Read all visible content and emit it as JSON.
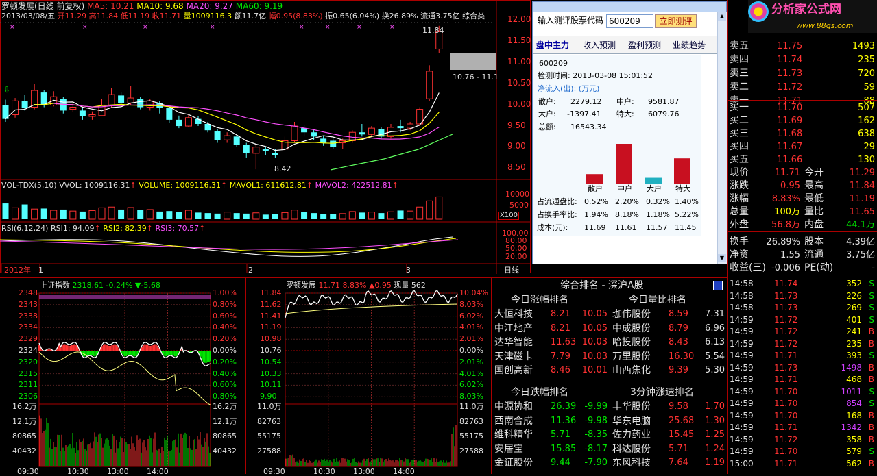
{
  "header": {
    "line1": {
      "name": "罗顿发展(日线 前复权)",
      "ma5": "MA5: 10.21",
      "ma10": "MA10: 9.68",
      "ma20": "MA20: 9.27",
      "ma60": "MA60: 9.19"
    },
    "line2": {
      "date": "2013/03/08/五",
      "open": "开11.29",
      "high": "高11.84",
      "low": "低11.19",
      "close": "收11.71",
      "vol": "量1009116.3",
      "amt": "额11.7亿",
      "chg": "幅0.95(8.83%)",
      "amp": "振0.65(6.04%)",
      "turn": "换26.89%",
      "float": "流通3.75亿",
      "comp": "综合类"
    }
  },
  "kline": {
    "price_labels": [
      "12.00",
      "11.50",
      "11.00",
      "10.50",
      "10.00",
      "9.50",
      "9.00",
      "8.50"
    ],
    "hi_mark": "11.84",
    "lo_mark": "8.42",
    "cursor_price": "10.76 - 11.1"
  },
  "vol_panel": {
    "title": "VOL-TDX(5,10)",
    "vvol": "VVOL: 1009116.31",
    "volume": "VOLUME: 1009116.31",
    "mavol1": "MAVOL1: 611612.81",
    "mavol2": "MAVOL2: 422512.81",
    "labels": [
      "10000",
      "5000"
    ],
    "unit": "X100"
  },
  "rsi_panel": {
    "title": "RSI(6,12,24)",
    "rsi1": "RSI1: 94.09",
    "rsi2": "RSI2: 82.39",
    "rsi3": "RSI3: 70.57",
    "labels": [
      "100.00",
      "80.00",
      "50.00",
      "20.00"
    ]
  },
  "timebar": {
    "year": "2012年",
    "m1": "1",
    "m2": "2",
    "m3": "3",
    "period": "日线"
  },
  "popup": {
    "input_label": "输入测评股票代码",
    "code": "600209",
    "btn": "立即测评",
    "tabs": [
      "盘中主力",
      "收入预测",
      "盈利预测",
      "业绩趋势"
    ],
    "code2": "600209",
    "time": "检测时间: 2013-03-08 15:01:52",
    "flow_title": "净流入(出): (万元)",
    "flow": {
      "sh_l": "散户:",
      "sh": "2279.12",
      "zh_l": "中户:",
      "zh": "9581.87",
      "dh_l": "大户:",
      "dh": "-1397.41",
      "th_l": "特大:",
      "th": "6079.76",
      "total_l": "总额:",
      "total": "16543.34"
    },
    "bars": {
      "labels": [
        "散户",
        "中户",
        "大户",
        "特大"
      ],
      "values": [
        2279.12,
        9581.87,
        -1397.41,
        6079.76
      ]
    },
    "rows": [
      {
        "label": "占流通盘比:",
        "v": [
          "0.52%",
          "2.20%",
          "0.32%",
          "1.40%"
        ]
      },
      {
        "label": "占换手率比:",
        "v": [
          "1.94%",
          "8.18%",
          "1.18%",
          "5.22%"
        ]
      },
      {
        "label": "成本(元):",
        "v": [
          "11.69",
          "11.61",
          "11.57",
          "11.45"
        ]
      }
    ]
  },
  "logo": {
    "main": "分析家公式网",
    "sub": "www.88gs.com"
  },
  "orderbook": {
    "sells": [
      {
        "l": "卖五",
        "p": "11.75",
        "v": "1493"
      },
      {
        "l": "卖四",
        "p": "11.74",
        "v": "235"
      },
      {
        "l": "卖三",
        "p": "11.73",
        "v": "720"
      },
      {
        "l": "卖二",
        "p": "11.72",
        "v": "59"
      },
      {
        "l": "卖一",
        "p": "11.71",
        "v": "88"
      }
    ],
    "buys": [
      {
        "l": "买一",
        "p": "11.70",
        "v": "507"
      },
      {
        "l": "买二",
        "p": "11.69",
        "v": "162"
      },
      {
        "l": "买三",
        "p": "11.68",
        "v": "638"
      },
      {
        "l": "买四",
        "p": "11.67",
        "v": "29"
      },
      {
        "l": "买五",
        "p": "11.66",
        "v": "130"
      }
    ]
  },
  "quote": [
    {
      "l1": "现价",
      "v1": "11.71",
      "l2": "今开",
      "v2": "11.29"
    },
    {
      "l1": "涨跌",
      "v1": "0.95",
      "l2": "最高",
      "v2": "11.84"
    },
    {
      "l1": "涨幅",
      "v1": "8.83%",
      "l2": "最低",
      "v2": "11.19"
    },
    {
      "l1": "总量",
      "v1": "100万",
      "l2": "量比",
      "v2": "11.65"
    },
    {
      "l1": "外盘",
      "v1": "56.8万",
      "l2": "内盘",
      "v2": "44.1万"
    },
    {
      "l1": "换手",
      "v1": "26.89%",
      "l2": "股本",
      "v2": "4.39亿"
    },
    {
      "l1": "净资",
      "v1": "1.55",
      "l2": "流通",
      "v2": "3.75亿"
    },
    {
      "l1": "收益(三)",
      "v1": "-0.006",
      "l2": "PE(动)",
      "v2": "-"
    }
  ],
  "ticks": [
    {
      "t": "14:58",
      "p": "11.74",
      "v": "352",
      "s": "S"
    },
    {
      "t": "14:58",
      "p": "11.73",
      "v": "226",
      "s": "S"
    },
    {
      "t": "14:58",
      "p": "11.73",
      "v": "269",
      "s": "S"
    },
    {
      "t": "14:59",
      "p": "11.72",
      "v": "401",
      "s": "S"
    },
    {
      "t": "14:59",
      "p": "11.72",
      "v": "241",
      "s": "B"
    },
    {
      "t": "14:59",
      "p": "11.72",
      "v": "235",
      "s": "B"
    },
    {
      "t": "14:59",
      "p": "11.71",
      "v": "393",
      "s": "S"
    },
    {
      "t": "14:59",
      "p": "11.73",
      "v": "1498",
      "s": "B"
    },
    {
      "t": "14:59",
      "p": "11.71",
      "v": "468",
      "s": "B"
    },
    {
      "t": "14:59",
      "p": "11.70",
      "v": "1011",
      "s": "S"
    },
    {
      "t": "14:59",
      "p": "11.70",
      "v": "854",
      "s": "S"
    },
    {
      "t": "14:59",
      "p": "11.70",
      "v": "168",
      "s": "B"
    },
    {
      "t": "14:59",
      "p": "11.71",
      "v": "1342",
      "s": "B"
    },
    {
      "t": "14:59",
      "p": "11.72",
      "v": "358",
      "s": "B"
    },
    {
      "t": "14:59",
      "p": "11.70",
      "v": "579",
      "s": "S"
    },
    {
      "t": "15:00",
      "p": "11.71",
      "v": "562",
      "s": "B"
    }
  ],
  "index_panel": {
    "title": "上证指数",
    "value": "2318.61",
    "chg": "-0.24%",
    "delta": "▼-5.68",
    "left": [
      "2348",
      "2343",
      "2338",
      "2334",
      "2329",
      "2324",
      "2320",
      "2315",
      "2311",
      "2306"
    ],
    "right": [
      "1.00%",
      "0.80%",
      "0.60%",
      "0.40%",
      "0.20%",
      "0.00%",
      "0.20%",
      "0.40%",
      "0.60%",
      "0.80%"
    ],
    "vol_l": [
      "16.2万",
      "12.1万",
      "80865",
      "40432"
    ],
    "times": [
      "09:30",
      "10:30",
      "13:00",
      "14:00"
    ]
  },
  "stock_panel": {
    "title": "罗顿发展",
    "value": "11.71",
    "pct": "8.83%",
    "delta": "▲0.95",
    "cur": "现量 562",
    "left": [
      "11.84",
      "11.62",
      "11.41",
      "11.19",
      "10.98",
      "10.76",
      "10.54",
      "10.33",
      "10.11",
      "9.90"
    ],
    "right": [
      "10.04%",
      "8.03%",
      "6.02%",
      "4.01%",
      "2.01%",
      "0.00%",
      "2.01%",
      "4.01%",
      "6.02%",
      "8.03%"
    ],
    "vol_l": [
      "11.0万",
      "82763",
      "55175",
      "27588"
    ],
    "times": [
      "09:30",
      "10:30",
      "13:00",
      "14:00"
    ]
  },
  "ranking": {
    "title": "综合排名 - 深沪A股",
    "up": {
      "title": "今日涨幅排名",
      "rows": [
        [
          "大恒科技",
          "8.21",
          "10.05"
        ],
        [
          "中江地产",
          "8.21",
          "10.05"
        ],
        [
          "达华智能",
          "11.63",
          "10.03"
        ],
        [
          "天津磁卡",
          "7.79",
          "10.03"
        ],
        [
          "国创高新",
          "8.46",
          "10.01"
        ]
      ]
    },
    "vr": {
      "title": "今日量比排名",
      "rows": [
        [
          "珈伟股份",
          "8.59",
          "7.31"
        ],
        [
          "中成股份",
          "8.79",
          "6.96"
        ],
        [
          "哈投股份",
          "8.43",
          "6.13"
        ],
        [
          "万里股份",
          "16.30",
          "5.54"
        ],
        [
          "山西焦化",
          "9.39",
          "5.30"
        ]
      ]
    },
    "down": {
      "title": "今日跌幅排名",
      "rows": [
        [
          "中源协和",
          "26.39",
          "-9.99"
        ],
        [
          "西南合成",
          "11.36",
          "-9.98"
        ],
        [
          "维科精华",
          "5.71",
          "-8.35"
        ],
        [
          "安居宝",
          "15.85",
          "-8.17"
        ],
        [
          "金证股份",
          "9.44",
          "-7.90"
        ]
      ]
    },
    "speed": {
      "title": "3分钟涨速排名",
      "rows": [
        [
          "丰华股份",
          "9.58",
          "1.70"
        ],
        [
          "华东电脑",
          "25.68",
          "1.30"
        ],
        [
          "佐力药业",
          "15.45",
          "1.25"
        ],
        [
          "科达股份",
          "5.71",
          "1.24"
        ],
        [
          "东风科技",
          "7.64",
          "1.19"
        ]
      ]
    }
  }
}
